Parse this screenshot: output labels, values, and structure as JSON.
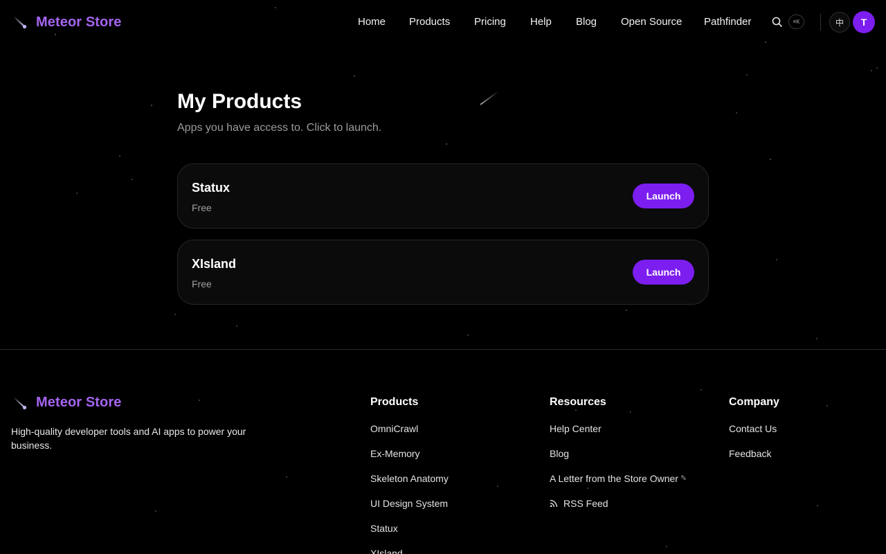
{
  "brand": {
    "name": "Meteor Store",
    "color": "#a565f0"
  },
  "nav": {
    "links": [
      "Home",
      "Products",
      "Pricing",
      "Help",
      "Blog",
      "Open Source",
      "Pathfinder"
    ],
    "search_icon": "search-icon",
    "shortcut_label": "⌘K",
    "language_label": "中",
    "avatar_initial": "T"
  },
  "main": {
    "title": "My Products",
    "subtitle": "Apps you have access to. Click to launch.",
    "products": [
      {
        "name": "Statux",
        "price": "Free",
        "action": "Launch"
      },
      {
        "name": "XIsland",
        "price": "Free",
        "action": "Launch"
      }
    ]
  },
  "footer": {
    "brand_name": "Meteor Store",
    "tagline": "High-quality developer tools and AI apps to power your business.",
    "columns": [
      {
        "title": "Products",
        "links": [
          "OmniCrawl",
          "Ex-Memory",
          "Skeleton Anatomy",
          "UI Design System",
          "Statux",
          "XIsland"
        ]
      },
      {
        "title": "Resources",
        "links": [
          "Help Center",
          "Blog",
          "A Letter from the Store Owner",
          "RSS Feed"
        ]
      },
      {
        "title": "Company",
        "links": [
          "Contact Us",
          "Feedback"
        ]
      }
    ]
  },
  "colors": {
    "accent": "#7c1ef0",
    "background": "#000000",
    "card_border": "#262626"
  }
}
